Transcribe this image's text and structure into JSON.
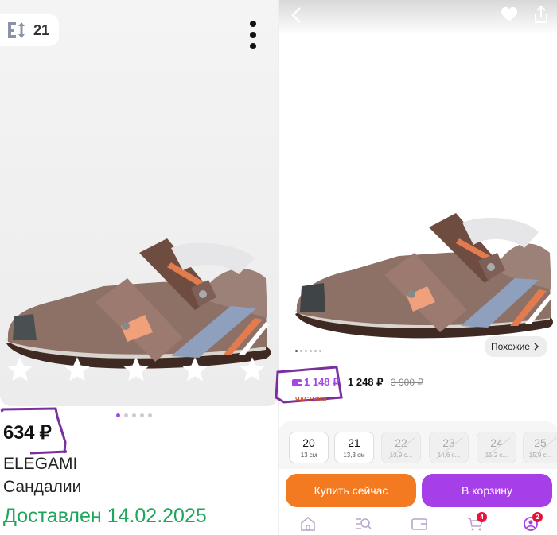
{
  "left": {
    "sizes_count": "21",
    "price": "634 ₽",
    "brand": "ELEGAMI",
    "product_name": "Сандалии",
    "delivery": "Доставлен 14.02.2025",
    "gallery_dots": 5,
    "gallery_active": 0,
    "annotation_color": "#7a2f9e"
  },
  "right": {
    "similar_label": "Похожие",
    "wallet_price": "1 148 ₽",
    "price": "1 248 ₽",
    "old_price": "3 900 ₽",
    "installment": "ЧАСТЯМИ",
    "sizes": [
      {
        "size": "20",
        "cm": "13 см",
        "available": true
      },
      {
        "size": "21",
        "cm": "13,3 см",
        "available": true
      },
      {
        "size": "22",
        "cm": "13,9 с...",
        "available": false
      },
      {
        "size": "23",
        "cm": "14,6 с...",
        "available": false
      },
      {
        "size": "24",
        "cm": "15,2 с...",
        "available": false
      },
      {
        "size": "25",
        "cm": "15,9 с...",
        "available": false
      }
    ],
    "buy_now": "Купить сейчас",
    "add_to_cart": "В корзину",
    "cart_badge": "4",
    "profile_badge": "2",
    "accent": "#a73fe9",
    "buy_color": "#f37a20"
  }
}
